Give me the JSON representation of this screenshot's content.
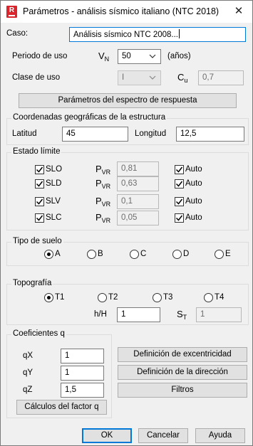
{
  "window": {
    "title": "Parámetros - análisis sísmico italiano (NTC 2018)",
    "close_glyph": "✕",
    "app_icon": "R"
  },
  "caso": {
    "label": "Caso:",
    "value": "Análisis sísmico NTC 2008..."
  },
  "periodo": {
    "label": "Periodo de uso",
    "symbol": "V",
    "sub": "N",
    "value": "50",
    "unit": "(años)"
  },
  "clase": {
    "label": "Clase de uso",
    "value": "I",
    "symbol": "C",
    "sub": "u",
    "cu_value": "0,7"
  },
  "spectrum_button": "Parámetros del espectro de respuesta",
  "coords": {
    "legend": "Coordenadas geográficas de la estructura",
    "lat_label": "Latitud",
    "lat_value": "45",
    "lon_label": "Longitud",
    "lon_value": "12,5"
  },
  "estado": {
    "legend": "Estado límite",
    "symbol": "P",
    "sub": "VR",
    "auto_label": "Auto",
    "rows": [
      {
        "name": "SLO",
        "value": "0,81"
      },
      {
        "name": "SLD",
        "value": "0,63"
      },
      {
        "name": "SLV",
        "value": "0,1"
      },
      {
        "name": "SLC",
        "value": "0,05"
      }
    ]
  },
  "suelo": {
    "legend": "Tipo de suelo",
    "options": [
      "A",
      "B",
      "C",
      "D",
      "E"
    ],
    "selected": "A"
  },
  "topografia": {
    "legend": "Topografía",
    "options": [
      "T1",
      "T2",
      "T3",
      "T4"
    ],
    "selected": "T1",
    "hh_label": "h/H",
    "hh_value": "1",
    "st_symbol": "S",
    "st_sub": "T",
    "st_value": "1"
  },
  "coef": {
    "legend": "Coeficientes q",
    "qx_label": "qX",
    "qx_value": "1",
    "qy_label": "qY",
    "qy_value": "1",
    "qz_label": "qZ",
    "qz_value": "1,5",
    "calc_button": "Cálculos del factor q"
  },
  "side_buttons": {
    "excentricidad": "Definición de excentricidad",
    "direccion": "Definición de la dirección",
    "filtros": "Filtros"
  },
  "footer": {
    "ok": "OK",
    "cancel": "Cancelar",
    "help": "Ayuda"
  }
}
